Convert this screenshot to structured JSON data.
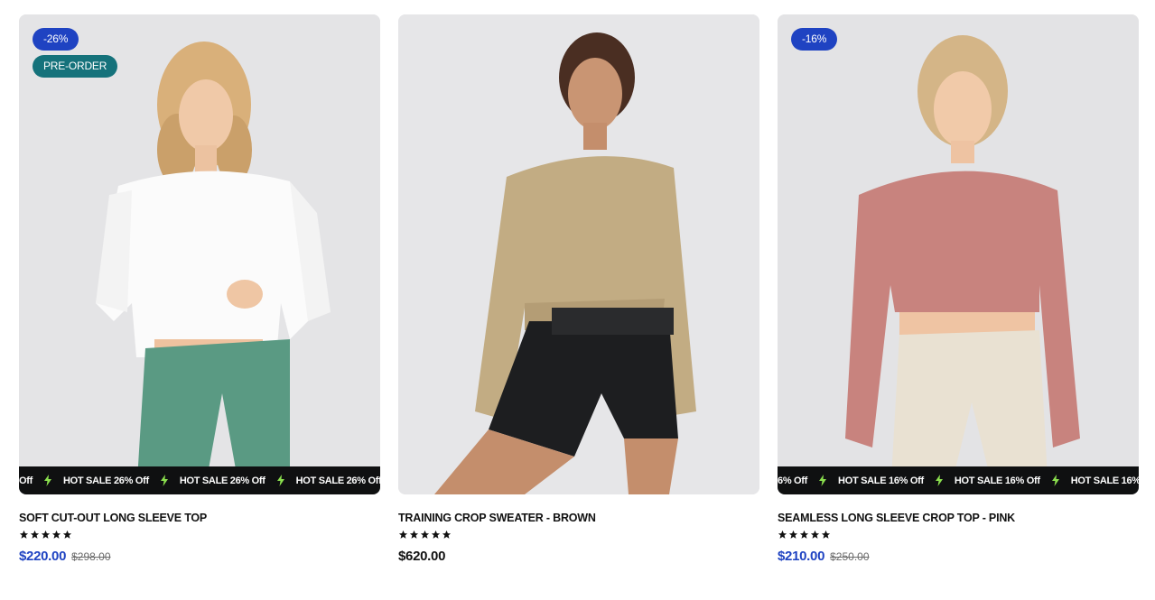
{
  "colors": {
    "accent": "#1f43c2",
    "preorder": "#15727b",
    "marquee_bg": "#0f1011",
    "bolt": "#8be04e",
    "image_bg": "#e6e6e8"
  },
  "products": [
    {
      "title": "SOFT CUT-OUT LONG SLEEVE TOP",
      "discount_badge": "-26%",
      "preorder_badge": "PRE-ORDER",
      "marquee_fragment": "Off",
      "marquee_text": "HOT SALE 26% Off",
      "rating": 5,
      "price": "$220.00",
      "compare_price": "$298.00",
      "image_desc_icon": "product-photo-icon"
    },
    {
      "title": "TRAINING CROP SWEATER - BROWN",
      "price": "$620.00",
      "rating": 5,
      "image_desc_icon": "product-photo-icon"
    },
    {
      "title": "SEAMLESS LONG SLEEVE CROP TOP - PINK",
      "discount_badge": "-16%",
      "marquee_fragment": "6% Off",
      "marquee_text": "HOT SALE 16% Off",
      "rating": 5,
      "price": "$210.00",
      "compare_price": "$250.00",
      "image_desc_icon": "product-photo-icon"
    }
  ]
}
